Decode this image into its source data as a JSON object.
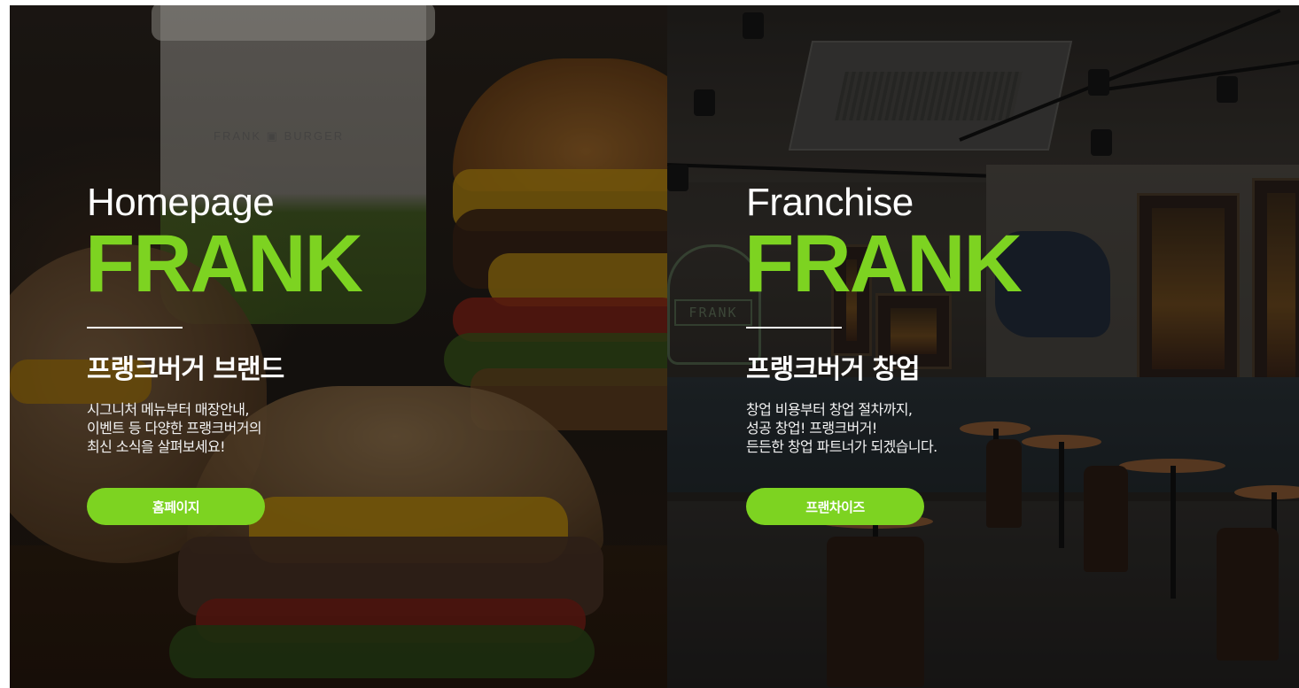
{
  "theme": {
    "accent": "#7dd321",
    "text": "#ffffff"
  },
  "panels": {
    "homepage": {
      "eyebrow": "Homepage",
      "brand": "FRANK",
      "heading": "프랭크버거 브랜드",
      "description": [
        "시그니처 메뉴부터 매장안내,",
        "이벤트 등 다양한 프랭크버거의",
        "최신 소식을 살펴보세요!"
      ],
      "button_label": "홈페이지",
      "background": "burger-photo"
    },
    "franchise": {
      "eyebrow": "Franchise",
      "brand": "FRANK",
      "heading": "프랭크버거 창업",
      "description": [
        "창업 비용부터 창업 절차까지,",
        "성공 창업! 프랭크버거!",
        "든든한 창업 파트너가 되겠습니다."
      ],
      "button_label": "프랜차이즈",
      "background": "store-interior-photo"
    }
  }
}
